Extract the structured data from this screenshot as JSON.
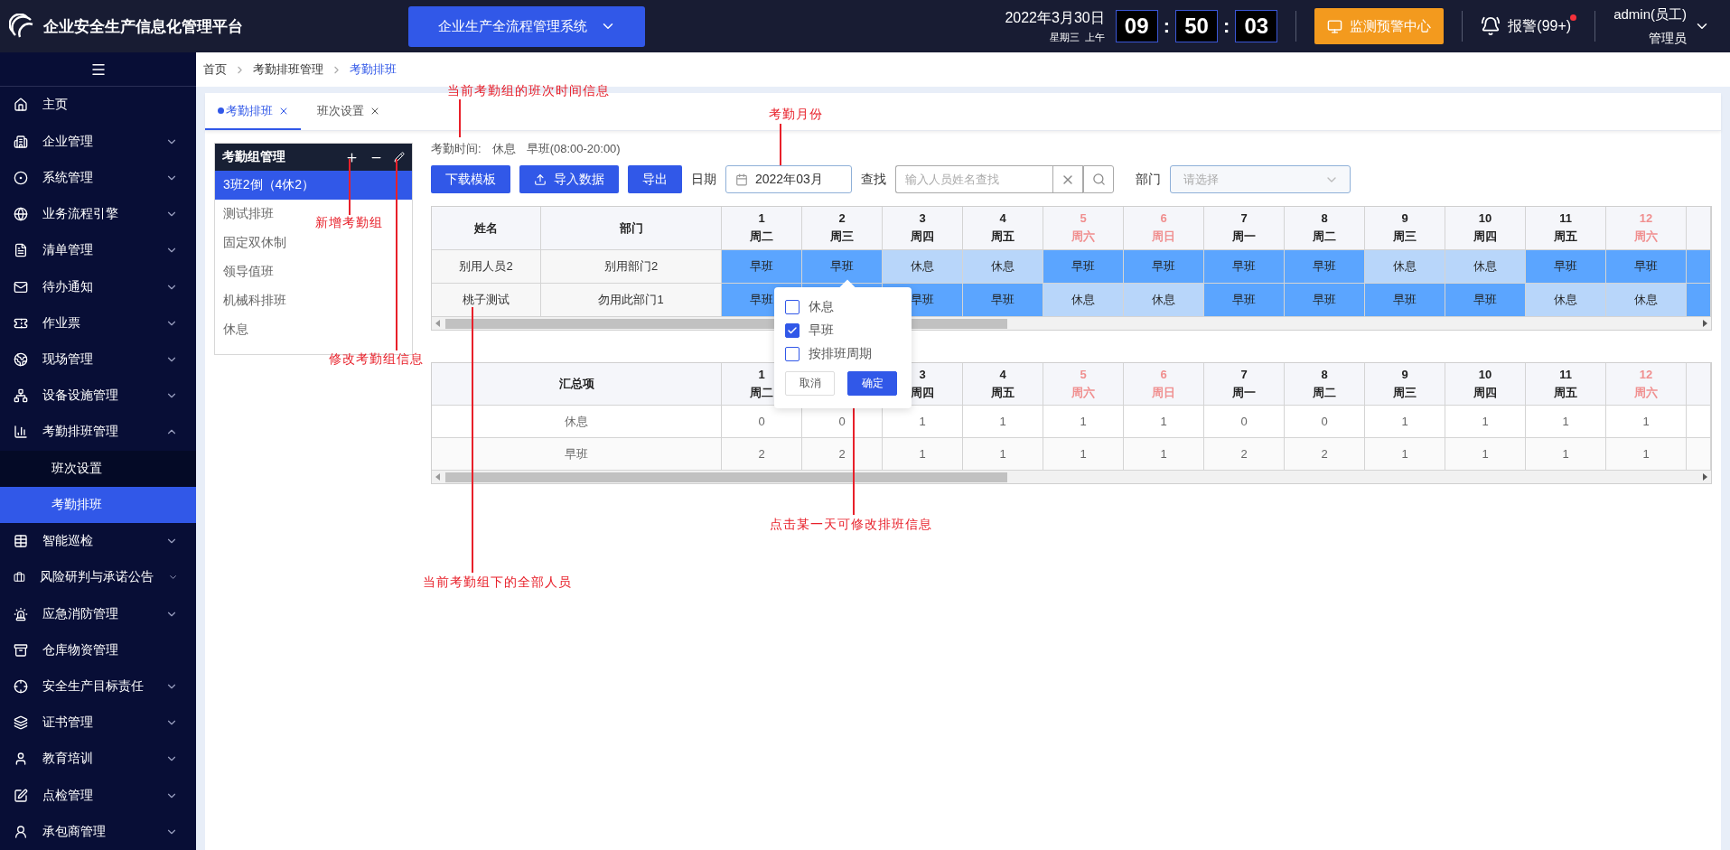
{
  "header": {
    "title": "企业安全生产信息化管理平台",
    "system_select": "企业生产全流程管理系统",
    "date": "2022年3月30日",
    "weekday": "星期三",
    "period": "上午",
    "clock": [
      {
        "kind": "digits",
        "text": "09"
      },
      {
        "kind": "separator",
        "text": ":"
      },
      {
        "kind": "digits",
        "text": "50"
      },
      {
        "kind": "separator",
        "text": ":"
      },
      {
        "kind": "digits",
        "text": "03"
      }
    ],
    "monitor_button": "监测预警中心",
    "alarm": {
      "label": "报警(99+)",
      "unread": true
    },
    "user": {
      "name": "admin(员工)",
      "role": "管理员"
    }
  },
  "sidebar": {
    "items": [
      {
        "label": "主页",
        "kind": "link",
        "selected": false
      },
      {
        "label": "企业管理",
        "kind": "group",
        "expanded": false,
        "selected": false
      },
      {
        "label": "系统管理",
        "kind": "group",
        "expanded": false,
        "selected": false
      },
      {
        "label": "业务流程引擎",
        "kind": "group",
        "expanded": false,
        "selected": false
      },
      {
        "label": "清单管理",
        "kind": "group",
        "expanded": false,
        "selected": false
      },
      {
        "label": "待办通知",
        "kind": "group",
        "expanded": false,
        "selected": false
      },
      {
        "label": "作业票",
        "kind": "group",
        "expanded": false,
        "selected": false
      },
      {
        "label": "现场管理",
        "kind": "group",
        "expanded": false,
        "selected": false
      },
      {
        "label": "设备设施管理",
        "kind": "group",
        "expanded": false,
        "selected": false
      },
      {
        "label": "考勤排班管理",
        "kind": "group",
        "expanded": true,
        "selected": false,
        "children": [
          {
            "label": "班次设置",
            "selected": false
          },
          {
            "label": "考勤排班",
            "selected": true
          }
        ]
      },
      {
        "label": "智能巡检",
        "kind": "group",
        "expanded": false,
        "selected": false
      },
      {
        "label": "风险研判与承诺公告",
        "kind": "group",
        "expanded": false,
        "selected": false
      },
      {
        "label": "应急消防管理",
        "kind": "group",
        "expanded": false,
        "selected": false
      },
      {
        "label": "仓库物资管理",
        "kind": "link",
        "selected": false
      },
      {
        "label": "安全生产目标责任",
        "kind": "group",
        "expanded": false,
        "selected": false
      },
      {
        "label": "证书管理",
        "kind": "group",
        "expanded": false,
        "selected": false
      },
      {
        "label": "教育培训",
        "kind": "group",
        "expanded": false,
        "selected": false
      },
      {
        "label": "点检管理",
        "kind": "group",
        "expanded": false,
        "selected": false
      },
      {
        "label": "承包商管理",
        "kind": "group",
        "expanded": false,
        "selected": false
      }
    ]
  },
  "breadcrumb": [
    "首页",
    "考勤排班管理",
    "考勤排班"
  ],
  "tabs": [
    {
      "label": "考勤排班",
      "selected": true
    },
    {
      "label": "班次设置",
      "selected": false
    }
  ],
  "group_panel": {
    "title": "考勤组管理",
    "items": [
      {
        "label": "3班2倒（4休2）",
        "selected": true
      },
      {
        "label": "测试排班",
        "selected": false
      },
      {
        "label": "固定双休制",
        "selected": false
      },
      {
        "label": "领导值班",
        "selected": false
      },
      {
        "label": "机械科排班",
        "selected": false
      },
      {
        "label": "休息",
        "selected": false
      }
    ]
  },
  "shift_info": {
    "label": "考勤时间:",
    "shifts": [
      "休息",
      "早班(08:00-20:00)"
    ]
  },
  "toolbar": {
    "buttons": [
      {
        "label": "下载模板",
        "kind": "plain"
      },
      {
        "label": "导入数据",
        "kind": "upload"
      },
      {
        "label": "导出",
        "kind": "plain"
      }
    ],
    "date_label": "日期",
    "date_value": "2022年03月",
    "search_label": "查找",
    "search_placeholder": "输入人员姓名查找",
    "dept_label": "部门",
    "dept_placeholder": "请选择"
  },
  "schedule_table": {
    "columns": [
      "姓名",
      "部门"
    ],
    "days": [
      {
        "day": "1",
        "weekday": "周二",
        "weekend": false
      },
      {
        "day": "2",
        "weekday": "周三",
        "weekend": false
      },
      {
        "day": "3",
        "weekday": "周四",
        "weekend": false
      },
      {
        "day": "4",
        "weekday": "周五",
        "weekend": false
      },
      {
        "day": "5",
        "weekday": "周六",
        "weekend": true
      },
      {
        "day": "6",
        "weekday": "周日",
        "weekend": true
      },
      {
        "day": "7",
        "weekday": "周一",
        "weekend": false
      },
      {
        "day": "8",
        "weekday": "周二",
        "weekend": false
      },
      {
        "day": "9",
        "weekday": "周三",
        "weekend": false
      },
      {
        "day": "10",
        "weekday": "周四",
        "weekend": false
      },
      {
        "day": "11",
        "weekday": "周五",
        "weekend": false
      },
      {
        "day": "12",
        "weekday": "周六",
        "weekend": true
      }
    ],
    "rows": [
      {
        "name": "别用人员2",
        "department": "别用部门2",
        "next_cell": {
          "kind": "day"
        },
        "cells": [
          {
            "text": "早班",
            "kind": "day"
          },
          {
            "text": "早班",
            "kind": "day"
          },
          {
            "text": "休息",
            "kind": "rest"
          },
          {
            "text": "休息",
            "kind": "rest"
          },
          {
            "text": "早班",
            "kind": "day"
          },
          {
            "text": "早班",
            "kind": "day"
          },
          {
            "text": "早班",
            "kind": "day"
          },
          {
            "text": "早班",
            "kind": "day"
          },
          {
            "text": "休息",
            "kind": "rest"
          },
          {
            "text": "休息",
            "kind": "rest"
          },
          {
            "text": "早班",
            "kind": "day"
          },
          {
            "text": "早班",
            "kind": "day"
          }
        ]
      },
      {
        "name": "桃子测试",
        "department": "勿用此部门1",
        "next_cell": {
          "kind": "day"
        },
        "cells": [
          {
            "text": "早班",
            "kind": "day"
          },
          {
            "kind": "day"
          },
          {
            "text": "早班",
            "kind": "day"
          },
          {
            "text": "早班",
            "kind": "day"
          },
          {
            "text": "休息",
            "kind": "rest"
          },
          {
            "text": "休息",
            "kind": "rest"
          },
          {
            "text": "早班",
            "kind": "day"
          },
          {
            "text": "早班",
            "kind": "day"
          },
          {
            "text": "早班",
            "kind": "day"
          },
          {
            "text": "早班",
            "kind": "day"
          },
          {
            "text": "休息",
            "kind": "rest"
          },
          {
            "text": "休息",
            "kind": "rest"
          }
        ]
      }
    ]
  },
  "summary_table": {
    "title": "汇总项",
    "days": [
      {
        "kind": "date",
        "day": "1",
        "weekday": "周二",
        "weekend": false
      },
      {
        "kind": "blank"
      },
      {
        "kind": "date",
        "day": "3",
        "weekday": "周四",
        "weekend": false
      },
      {
        "kind": "date",
        "day": "4",
        "weekday": "周五",
        "weekend": false
      },
      {
        "kind": "date",
        "day": "5",
        "weekday": "周六",
        "weekend": true
      },
      {
        "kind": "date",
        "day": "6",
        "weekday": "周日",
        "weekend": true
      },
      {
        "kind": "date",
        "day": "7",
        "weekday": "周一",
        "weekend": false
      },
      {
        "kind": "date",
        "day": "8",
        "weekday": "周二",
        "weekend": false
      },
      {
        "kind": "date",
        "day": "9",
        "weekday": "周三",
        "weekend": false
      },
      {
        "kind": "date",
        "day": "10",
        "weekday": "周四",
        "weekend": false
      },
      {
        "kind": "date",
        "day": "11",
        "weekday": "周五",
        "weekend": false
      },
      {
        "kind": "date",
        "day": "12",
        "weekday": "周六",
        "weekend": true
      }
    ],
    "rows": [
      {
        "label": "休息",
        "values": [
          "0",
          "0",
          "1",
          "1",
          "1",
          "1",
          "0",
          "0",
          "1",
          "1",
          "1",
          "1"
        ]
      },
      {
        "label": "早班",
        "values": [
          "2",
          "2",
          "1",
          "1",
          "1",
          "1",
          "2",
          "2",
          "1",
          "1",
          "1",
          "1"
        ]
      }
    ]
  },
  "popup": {
    "options": [
      {
        "label": "休息",
        "checked": false
      },
      {
        "label": "早班",
        "checked": true
      },
      {
        "label": "按排班周期",
        "checked": false
      }
    ],
    "cancel": "取消",
    "confirm": "确定"
  },
  "annotations": [
    "当前考勤组的班次时间信息",
    "考勤月份",
    "新增考勤组",
    "修改考勤组信息",
    "当前考勤组下的全部人员",
    "点击某一天可修改排班信息"
  ]
}
